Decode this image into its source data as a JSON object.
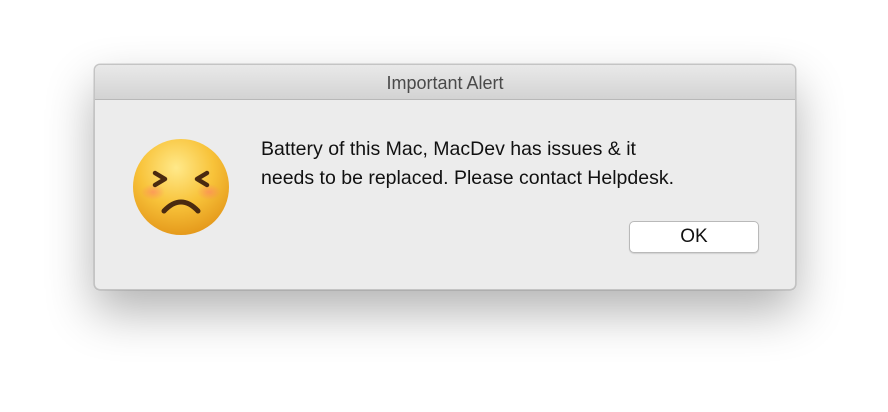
{
  "window": {
    "title": "Important Alert"
  },
  "alert": {
    "icon": "persevering-face-icon",
    "message_lines": [
      "Battery of this Mac, MacDev has issues & it",
      "needs to be replaced. Please contact Helpdesk."
    ],
    "ok_label": "OK"
  },
  "colors": {
    "window_background": "#ececec",
    "titlebar_text": "#4a4a4a",
    "emoji_face": "#f4b92d"
  }
}
